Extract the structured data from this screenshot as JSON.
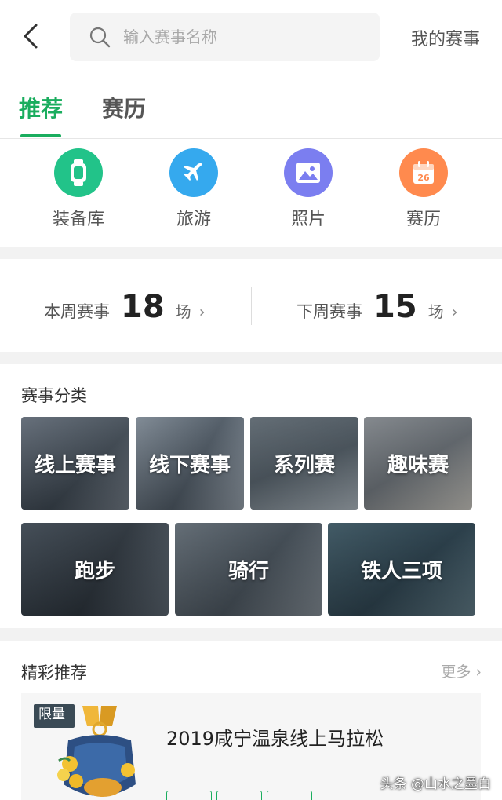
{
  "header": {
    "search_placeholder": "输入赛事名称",
    "my_events": "我的赛事"
  },
  "tabs": [
    {
      "label": "推荐",
      "active": true
    },
    {
      "label": "赛历",
      "active": false
    }
  ],
  "quick_links": [
    {
      "label": "装备库",
      "icon": "watch-icon",
      "color": "#22c389"
    },
    {
      "label": "旅游",
      "icon": "airplane-icon",
      "color": "#35a9ee"
    },
    {
      "label": "照片",
      "icon": "photo-icon",
      "color": "#7b7ef0"
    },
    {
      "label": "赛历",
      "icon": "calendar-icon",
      "color": "#ff8a4e",
      "badge": "26"
    }
  ],
  "weekly": {
    "this_week_label": "本周赛事",
    "this_week_count": "18",
    "next_week_label": "下周赛事",
    "next_week_count": "15",
    "unit": "场"
  },
  "category": {
    "title": "赛事分类",
    "row1": [
      "线上赛事",
      "线下赛事",
      "系列赛",
      "趣味赛"
    ],
    "row2": [
      "跑步",
      "骑行",
      "铁人三项"
    ]
  },
  "recommend": {
    "title": "精彩推荐",
    "more": "更多",
    "card": {
      "badge": "限量",
      "title": "2019咸宁温泉线上马拉松",
      "tags": [
        "",
        "",
        ""
      ]
    }
  },
  "watermark": "头条 @山水之墨白"
}
